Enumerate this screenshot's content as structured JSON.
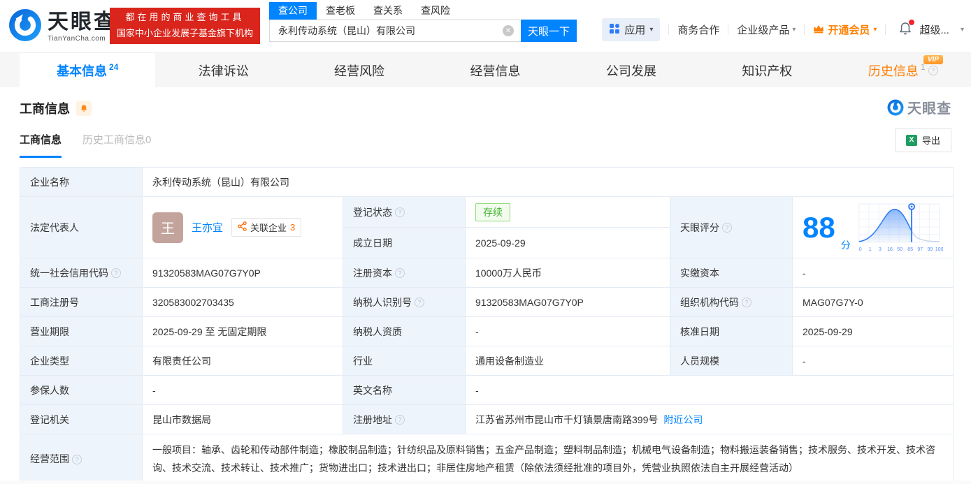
{
  "colors": {
    "brand_blue": "#0084ff",
    "banner_red": "#d9251c",
    "orange": "#ff8000",
    "status_green": "#43b431",
    "label_bg": "#eef4fb"
  },
  "icons": {
    "caret_down": "▾",
    "question": "?",
    "clear": "✕",
    "excel": "X"
  },
  "header": {
    "logo_cn": "天眼查",
    "logo_en": "TianYanCha.com",
    "banner_line1": "都在用的商业查询工具",
    "banner_line2": "国家中小企业发展子基金旗下机构",
    "search_tabs": [
      {
        "label": "查公司"
      },
      {
        "label": "查老板"
      },
      {
        "label": "查关系"
      },
      {
        "label": "查风险"
      }
    ],
    "search_value": "永利传动系统（昆山）有限公司",
    "search_button": "天眼一下",
    "menu_apps": "应用",
    "menu_cooperation": "商务合作",
    "menu_enterprise": "企业级产品",
    "menu_vip": "开通会员",
    "menu_super": "超级..."
  },
  "vip_badge": "VIP",
  "nav_tabs": [
    {
      "label": "基本信息",
      "count": "24"
    },
    {
      "label": "法律诉讼",
      "count": ""
    },
    {
      "label": "经营风险",
      "count": ""
    },
    {
      "label": "经营信息",
      "count": ""
    },
    {
      "label": "公司发展",
      "count": ""
    },
    {
      "label": "知识产权",
      "count": ""
    },
    {
      "label": "历史信息",
      "count": "1"
    }
  ],
  "section": {
    "title": "工商信息",
    "watermark": "天眼查",
    "subtab_active": "工商信息",
    "subtab_history": "历史工商信息0",
    "export_label": "导出"
  },
  "table": {
    "company_name_label": "企业名称",
    "company_name": "永利传动系统（昆山）有限公司",
    "legal_rep_label": "法定代表人",
    "legal_rep_avatar": "王",
    "legal_rep_name": "王亦宜",
    "related_label": "关联企业",
    "related_count": "3",
    "reg_status_label": "登记状态",
    "reg_status": "存续",
    "establish_label": "成立日期",
    "establish_date": "2025-09-29",
    "score_label": "天眼评分",
    "score_value": "88",
    "score_unit": "分",
    "credit_code_label": "统一社会信用代码",
    "credit_code": "91320583MAG07G7Y0P",
    "reg_capital_label": "注册资本",
    "reg_capital": "10000万人民币",
    "paid_capital_label": "实缴资本",
    "paid_capital": "-",
    "reg_number_label": "工商注册号",
    "reg_number": "320583002703435",
    "taxpayer_id_label": "纳税人识别号",
    "taxpayer_id": "91320583MAG07G7Y0P",
    "org_code_label": "组织机构代码",
    "org_code": "MAG07G7Y-0",
    "business_term_label": "营业期限",
    "business_term": "2025-09-29 至 无固定期限",
    "taxpayer_quality_label": "纳税人资质",
    "taxpayer_quality": "-",
    "approval_date_label": "核准日期",
    "approval_date": "2025-09-29",
    "company_type_label": "企业类型",
    "company_type": "有限责任公司",
    "industry_label": "行业",
    "industry": "通用设备制造业",
    "staff_size_label": "人员规模",
    "staff_size": "-",
    "insured_label": "参保人数",
    "insured": "-",
    "english_name_label": "英文名称",
    "english_name": "-",
    "reg_authority_label": "登记机关",
    "reg_authority": "昆山市数据局",
    "reg_address_label": "注册地址",
    "reg_address": "江苏省苏州市昆山市千灯镇景唐南路399号",
    "nearby_link": "附近公司",
    "business_scope_label": "经营范围",
    "business_scope": "一般项目：轴承、齿轮和传动部件制造；橡胶制品制造；针纺织品及原料销售；五金产品制造；塑料制品制造；机械电气设备制造；物料搬运装备销售；技术服务、技术开发、技术咨询、技术交流、技术转让、技术推广；货物进出口；技术进出口；非居住房地产租赁（除依法须经批准的项目外，凭营业执照依法自主开展经营活动）"
  },
  "score_chart": {
    "type": "area",
    "x_labels": [
      "0",
      "1",
      "3",
      "16",
      "50",
      "85",
      "97",
      "99",
      "100"
    ],
    "marker_value": 88,
    "curve_color": "#2e7cf6",
    "tail_color": "#c9d6e8"
  }
}
